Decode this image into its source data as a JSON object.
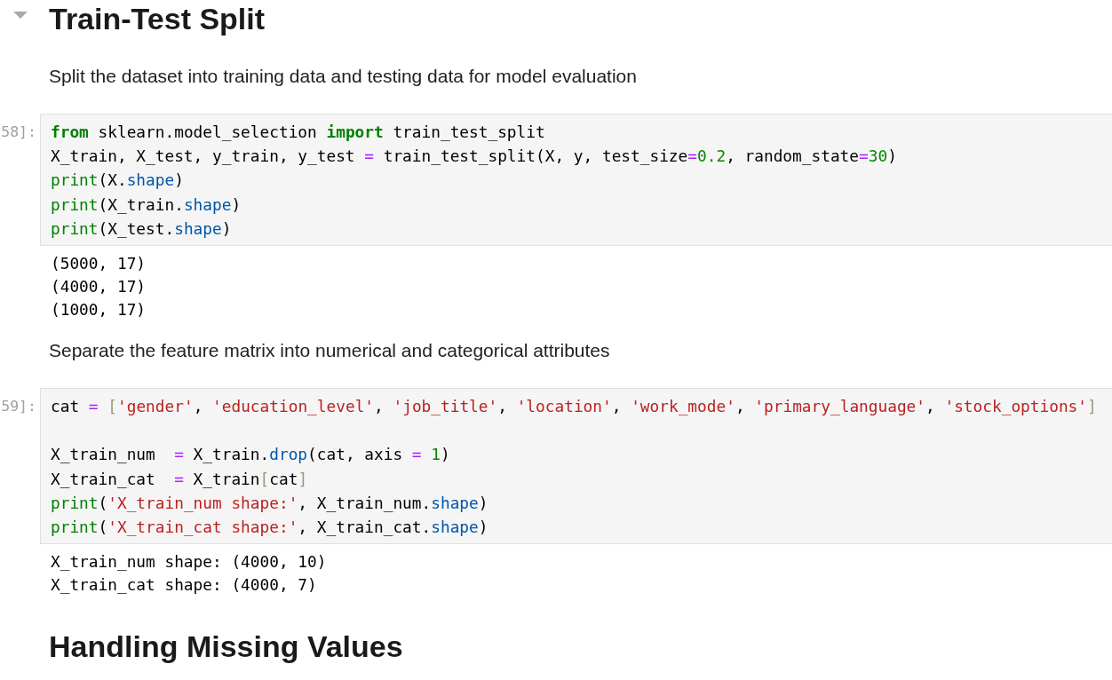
{
  "cells": [
    {
      "kind": "heading",
      "text": "Train-Test Split",
      "collapser": {
        "expanded": true
      }
    },
    {
      "kind": "markdown",
      "text": "Split the dataset into training data and testing data for model evaluation"
    },
    {
      "kind": "code",
      "prompt": "58]:",
      "lines": [
        {
          "kind": "code",
          "tokens": [
            {
              "kind": "keyword",
              "text": "from"
            },
            {
              "kind": "name",
              "text": " sklearn.model_selection "
            },
            {
              "kind": "keyword",
              "text": "import"
            },
            {
              "kind": "name",
              "text": " train_test_split"
            }
          ]
        },
        {
          "kind": "code",
          "tokens": [
            {
              "kind": "name",
              "text": "X_train, X_test, y_train, y_test "
            },
            {
              "kind": "operator",
              "text": "="
            },
            {
              "kind": "name",
              "text": " train_test_split(X, y, test_size"
            },
            {
              "kind": "operator",
              "text": "="
            },
            {
              "kind": "number",
              "text": "0.2"
            },
            {
              "kind": "name",
              "text": ", random_state"
            },
            {
              "kind": "operator",
              "text": "="
            },
            {
              "kind": "number",
              "text": "30"
            },
            {
              "kind": "name",
              "text": ")"
            }
          ]
        },
        {
          "kind": "code",
          "tokens": [
            {
              "kind": "builtin",
              "text": "print"
            },
            {
              "kind": "name",
              "text": "(X."
            },
            {
              "kind": "attribute",
              "text": "shape"
            },
            {
              "kind": "name",
              "text": ")"
            }
          ]
        },
        {
          "kind": "code",
          "tokens": [
            {
              "kind": "builtin",
              "text": "print"
            },
            {
              "kind": "name",
              "text": "(X_train."
            },
            {
              "kind": "attribute",
              "text": "shape"
            },
            {
              "kind": "name",
              "text": ")"
            }
          ]
        },
        {
          "kind": "code",
          "tokens": [
            {
              "kind": "builtin",
              "text": "print"
            },
            {
              "kind": "name",
              "text": "(X_test."
            },
            {
              "kind": "attribute",
              "text": "shape"
            },
            {
              "kind": "name",
              "text": ")"
            }
          ]
        }
      ],
      "output": [
        "(5000, 17)",
        "(4000, 17)",
        "(1000, 17)"
      ]
    },
    {
      "kind": "markdown",
      "text": "Separate the feature matrix into numerical and categorical attributes"
    },
    {
      "kind": "code",
      "prompt": "59]:",
      "lines": [
        {
          "kind": "code",
          "tokens": [
            {
              "kind": "name",
              "text": "cat "
            },
            {
              "kind": "operator",
              "text": "= "
            },
            {
              "kind": "bracket",
              "text": "["
            },
            {
              "kind": "string",
              "text": "'gender'"
            },
            {
              "kind": "name",
              "text": ", "
            },
            {
              "kind": "string",
              "text": "'education_level'"
            },
            {
              "kind": "name",
              "text": ", "
            },
            {
              "kind": "string",
              "text": "'job_title'"
            },
            {
              "kind": "name",
              "text": ", "
            },
            {
              "kind": "string",
              "text": "'location'"
            },
            {
              "kind": "name",
              "text": ", "
            },
            {
              "kind": "string",
              "text": "'work_mode'"
            },
            {
              "kind": "name",
              "text": ", "
            },
            {
              "kind": "string",
              "text": "'primary_language'"
            },
            {
              "kind": "name",
              "text": ", "
            },
            {
              "kind": "string",
              "text": "'stock_options'"
            },
            {
              "kind": "bracket",
              "text": "]"
            }
          ]
        },
        {
          "kind": "blank"
        },
        {
          "kind": "code",
          "tokens": [
            {
              "kind": "name",
              "text": "X_train_num  "
            },
            {
              "kind": "operator",
              "text": "= "
            },
            {
              "kind": "name",
              "text": "X_train."
            },
            {
              "kind": "attribute",
              "text": "drop"
            },
            {
              "kind": "name",
              "text": "(cat, axis "
            },
            {
              "kind": "operator",
              "text": "= "
            },
            {
              "kind": "number",
              "text": "1"
            },
            {
              "kind": "name",
              "text": ")"
            }
          ]
        },
        {
          "kind": "code",
          "tokens": [
            {
              "kind": "name",
              "text": "X_train_cat  "
            },
            {
              "kind": "operator",
              "text": "= "
            },
            {
              "kind": "name",
              "text": "X_train"
            },
            {
              "kind": "bracket",
              "text": "["
            },
            {
              "kind": "name",
              "text": "cat"
            },
            {
              "kind": "bracket",
              "text": "]"
            }
          ]
        },
        {
          "kind": "code",
          "tokens": [
            {
              "kind": "builtin",
              "text": "print"
            },
            {
              "kind": "name",
              "text": "("
            },
            {
              "kind": "string",
              "text": "'X_train_num shape:'"
            },
            {
              "kind": "name",
              "text": ", X_train_num."
            },
            {
              "kind": "attribute",
              "text": "shape"
            },
            {
              "kind": "name",
              "text": ")"
            }
          ]
        },
        {
          "kind": "code",
          "tokens": [
            {
              "kind": "builtin",
              "text": "print"
            },
            {
              "kind": "name",
              "text": "("
            },
            {
              "kind": "string",
              "text": "'X_train_cat shape:'"
            },
            {
              "kind": "name",
              "text": ", X_train_cat."
            },
            {
              "kind": "attribute",
              "text": "shape"
            },
            {
              "kind": "name",
              "text": ")"
            }
          ]
        }
      ],
      "output": [
        "X_train_num shape: (4000, 10)",
        "X_train_cat shape: (4000, 7)"
      ]
    },
    {
      "kind": "heading",
      "text": "Handling Missing Values"
    }
  ]
}
